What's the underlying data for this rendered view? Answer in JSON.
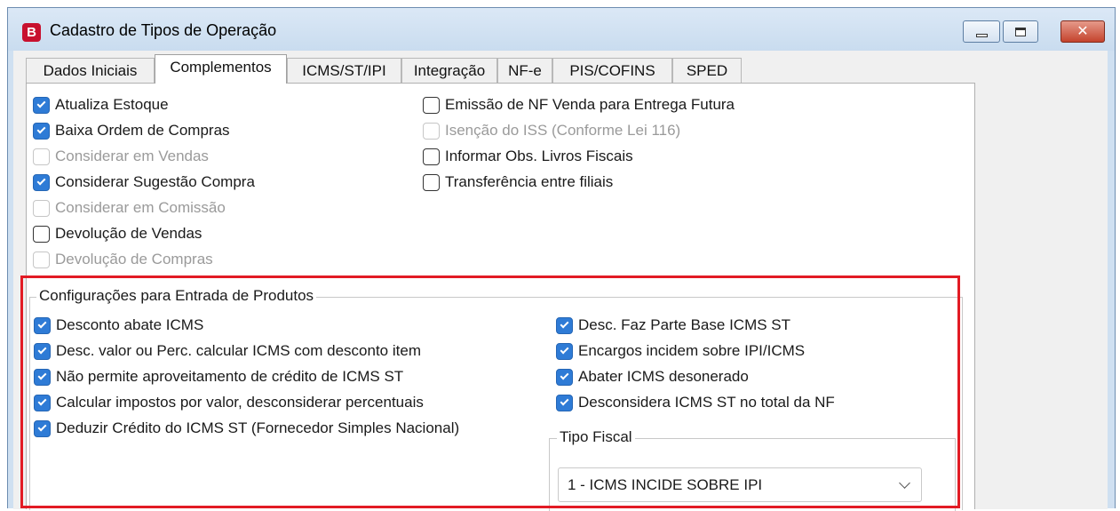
{
  "window": {
    "title": "Cadastro de Tipos de Operação",
    "app_icon_letter": "B",
    "close_symbol": "✕"
  },
  "tabs": [
    {
      "label": "Dados Iniciais",
      "active": false
    },
    {
      "label": "Complementos",
      "active": true
    },
    {
      "label": "ICMS/ST/IPI",
      "active": false
    },
    {
      "label": "Integração",
      "active": false
    },
    {
      "label": "NF-e",
      "active": false
    },
    {
      "label": "PIS/COFINS",
      "active": false
    },
    {
      "label": "SPED",
      "active": false
    }
  ],
  "options_left": [
    {
      "label": "Atualiza Estoque",
      "checked": true,
      "enabled": true
    },
    {
      "label": "Baixa Ordem de Compras",
      "checked": true,
      "enabled": true
    },
    {
      "label": "Considerar em Vendas",
      "checked": false,
      "enabled": false
    },
    {
      "label": "Considerar Sugestão Compra",
      "checked": true,
      "enabled": true
    },
    {
      "label": "Considerar em Comissão",
      "checked": false,
      "enabled": false
    },
    {
      "label": "Devolução de Vendas",
      "checked": false,
      "enabled": true
    },
    {
      "label": "Devolução de Compras",
      "checked": false,
      "enabled": false
    }
  ],
  "options_right": [
    {
      "label": "Emissão de NF Venda para Entrega Futura",
      "checked": false,
      "enabled": true
    },
    {
      "label": "Isenção do ISS (Conforme Lei 116)",
      "checked": false,
      "enabled": false
    },
    {
      "label": "Informar Obs. Livros Fiscais",
      "checked": false,
      "enabled": true
    },
    {
      "label": "Transferência entre filiais",
      "checked": false,
      "enabled": true
    }
  ],
  "entrada": {
    "title": "Configurações para Entrada de Produtos",
    "left": [
      {
        "label": "Desconto abate ICMS",
        "checked": true
      },
      {
        "label": "Desc. valor ou Perc. calcular ICMS com desconto item",
        "checked": true
      },
      {
        "label": "Não permite aproveitamento de crédito de ICMS ST",
        "checked": true
      },
      {
        "label": "Calcular impostos por valor, desconsiderar percentuais",
        "checked": true
      },
      {
        "label": "Deduzir Crédito do ICMS ST (Fornecedor Simples Nacional)",
        "checked": true
      }
    ],
    "right": [
      {
        "label": "Desc. Faz Parte Base ICMS ST",
        "checked": true
      },
      {
        "label": "Encargos incidem sobre IPI/ICMS",
        "checked": true
      },
      {
        "label": "Abater ICMS desonerado",
        "checked": true
      },
      {
        "label": "Desconsidera ICMS ST no total da NF",
        "checked": true
      }
    ],
    "tipo_fiscal": {
      "title": "Tipo Fiscal",
      "selected": "1 - ICMS INCIDE SOBRE IPI"
    }
  },
  "colors": {
    "highlight": "#e21b24",
    "checkbox_checked": "#2e7bd6"
  }
}
